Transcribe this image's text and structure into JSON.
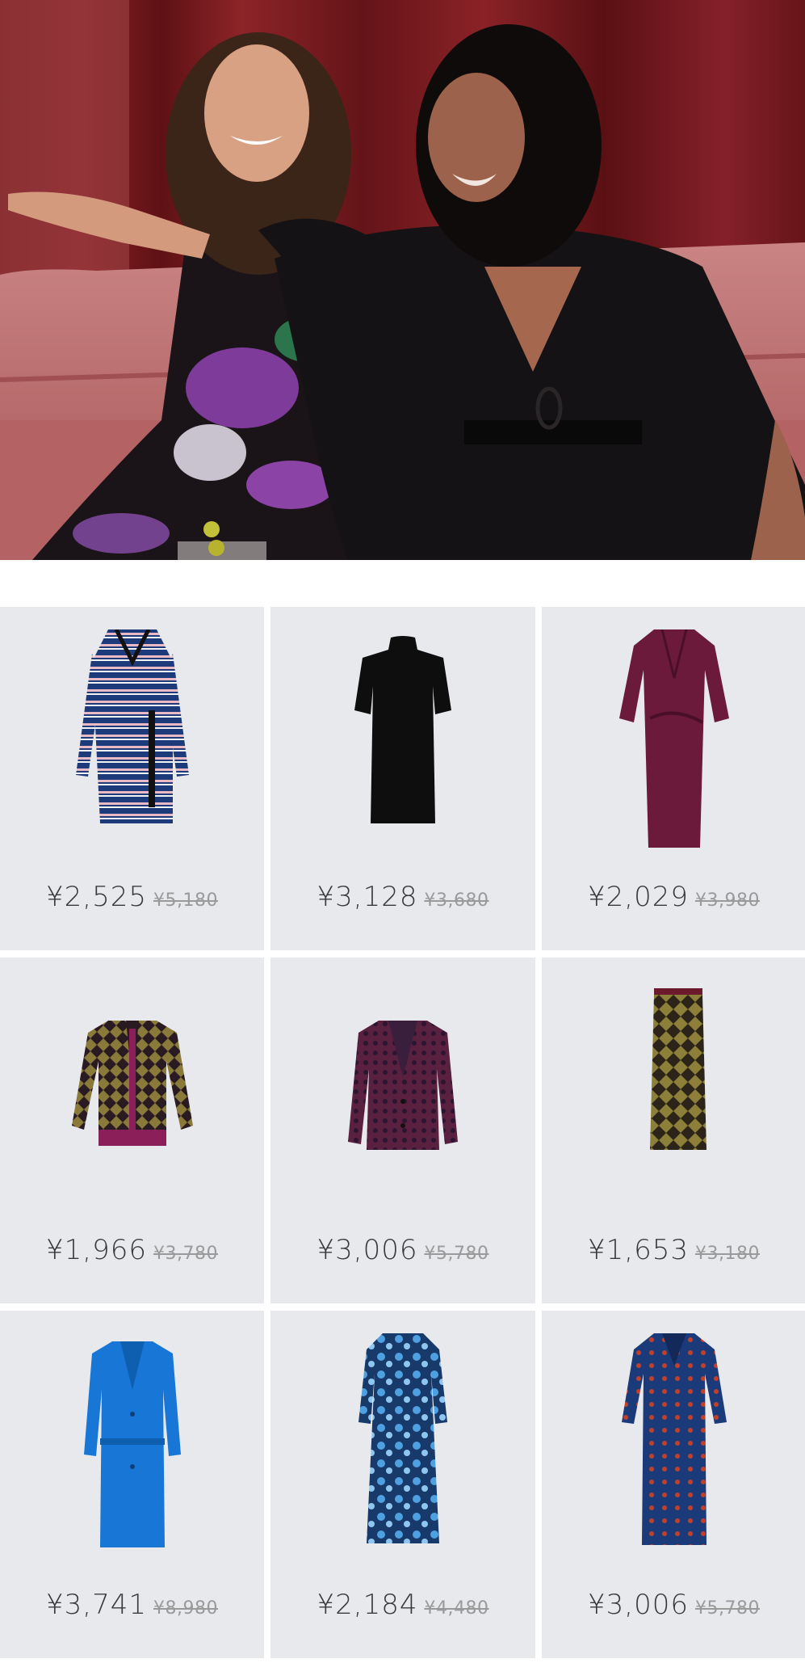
{
  "hero": {
    "colors": {
      "curtain": "#7a1d22",
      "sofa": "#c9787a",
      "dress_black": "#141214",
      "print_purple": "#8b3fa8"
    }
  },
  "products": [
    {
      "price": "¥2,525",
      "original_price": "¥5,180",
      "item": "striped-wrap-dress",
      "colors": [
        "#1d3b7a",
        "#e9b9c4",
        "#111111"
      ]
    },
    {
      "price": "¥3,128",
      "original_price": "¥3,680",
      "item": "black-knit-dress",
      "colors": [
        "#0e0e0e"
      ]
    },
    {
      "price": "¥2,029",
      "original_price": "¥3,980",
      "item": "plum-wrap-maxi-dress",
      "colors": [
        "#6b1a3c"
      ]
    },
    {
      "price": "¥1,966",
      "original_price": "¥3,780",
      "item": "geometric-cardigan",
      "colors": [
        "#8a7a3a",
        "#2a1a22",
        "#8a1f5a"
      ]
    },
    {
      "price": "¥3,006",
      "original_price": "¥5,780",
      "item": "printed-blazer",
      "colors": [
        "#5a2040",
        "#3a1f3d"
      ]
    },
    {
      "price": "¥1,653",
      "original_price": "¥3,180",
      "item": "geometric-pencil-skirt",
      "colors": [
        "#8c7f3a",
        "#2c2418"
      ]
    },
    {
      "price": "¥3,741",
      "original_price": "¥8,980",
      "item": "blue-belted-coat",
      "colors": [
        "#1877d6"
      ]
    },
    {
      "price": "¥2,184",
      "original_price": "¥4,480",
      "item": "blue-floral-midi-dress",
      "colors": [
        "#173a6a",
        "#4fa0e0"
      ]
    },
    {
      "price": "¥3,006",
      "original_price": "¥5,780",
      "item": "navy-dot-shirt-dress",
      "colors": [
        "#1b3a7a",
        "#c0402a"
      ]
    }
  ]
}
